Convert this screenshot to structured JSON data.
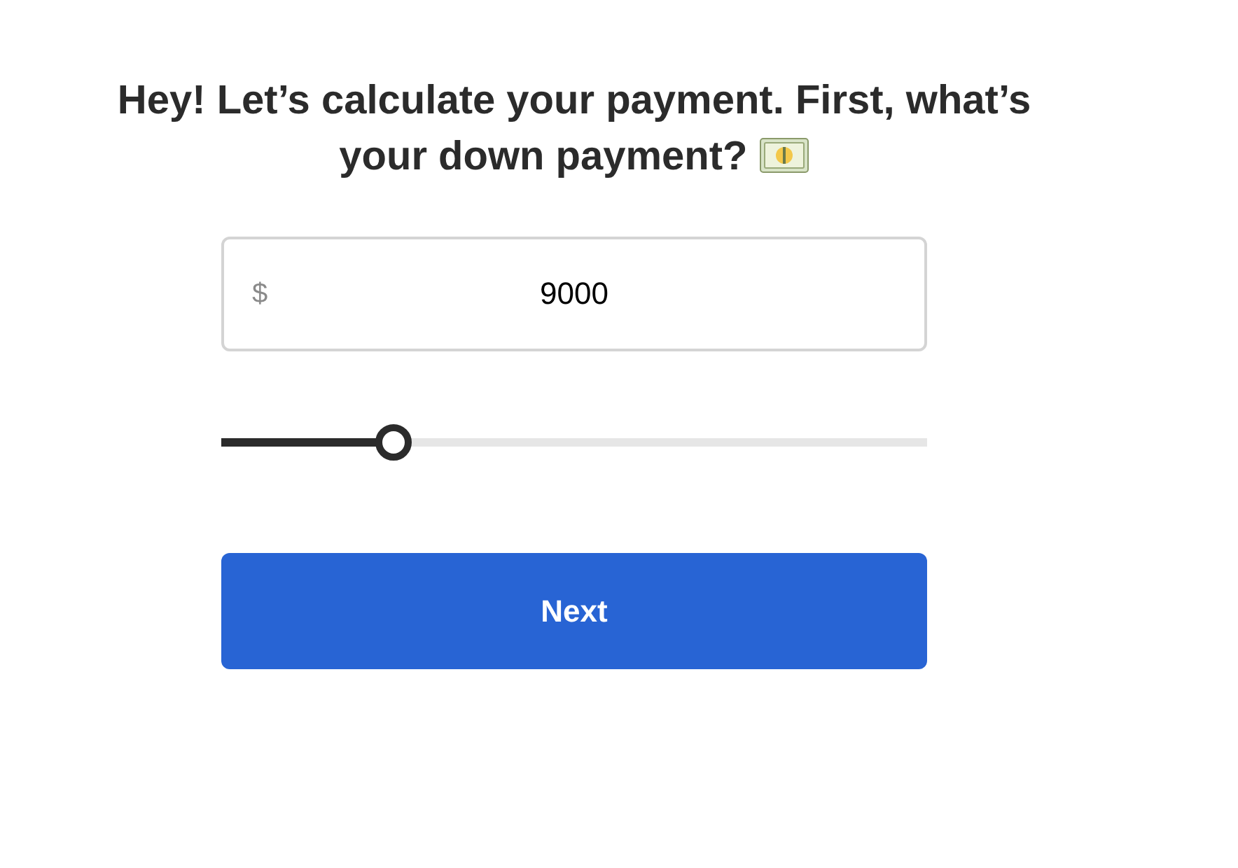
{
  "heading": "Hey! Let’s calculate your payment. First, what’s your down payment?",
  "amount_field": {
    "prefix": "$",
    "value": "9000"
  },
  "slider": {
    "level": 0.244
  },
  "next_button": {
    "label": "Next"
  }
}
